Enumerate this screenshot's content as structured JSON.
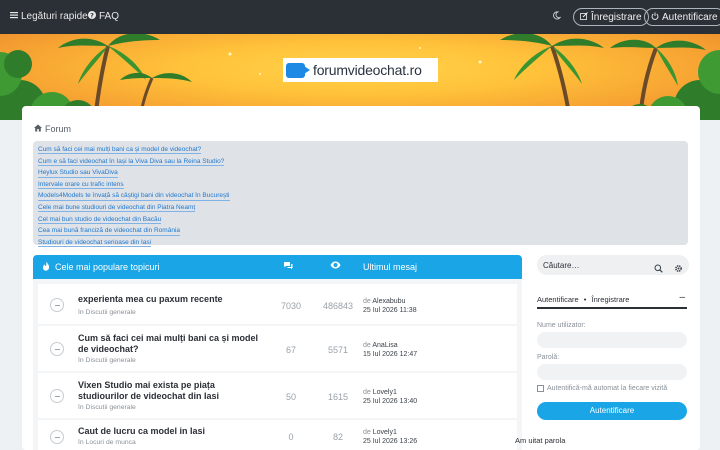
{
  "topbar": {
    "quick_links": "Legături rapide",
    "faq": "FAQ",
    "register": "Înregistrare",
    "login": "Autentificare"
  },
  "banner": {
    "logo_text": "forumvideochat.ro",
    "colors": {
      "sky": "#ffc23a",
      "leaves": "#2f7d2a"
    }
  },
  "breadcrumb": {
    "label": "Forum"
  },
  "links": [
    "Cum să faci cei mai mulți bani ca și model de videochat?",
    "Cum e să faci videochat în Iași la Viva Diva sau la Reina Studio?",
    "Heylux Studio sau VivaDiva",
    "Intervale orare cu trafic intens",
    "Models4Models te învață să câștigi bani din videochat în București",
    "Cele mai bune studiouri de videochat din Piatra Neamț",
    "Cel mai bun studio de videochat din Bacău",
    "Cea mai bună franciză de videochat din România",
    "Studiouri de videochat serioase din Iasi"
  ],
  "topics": {
    "header": "Cele mai populare topicuri",
    "last_post_header": "Ultimul mesaj",
    "accent": "#1aa5e6",
    "rows": [
      {
        "title": "experienta mea cu paxum recente",
        "forum": "în Discutii generale",
        "replies": "7030",
        "views": "486843",
        "by_prefix": "de",
        "author": "Alexabubu",
        "date": "25 Iul 2026 11:38"
      },
      {
        "title": "Cum să faci cei mai mulți bani ca și model de videochat?",
        "forum": "în Discutii generale",
        "replies": "67",
        "views": "5571",
        "by_prefix": "de",
        "author": "AnaLisa",
        "date": "15 Iul 2026 12:47"
      },
      {
        "title": "Vixen Studio mai exista pe piața studiourilor de videochat din Iasi",
        "forum": "în Discutii generale",
        "replies": "50",
        "views": "1615",
        "by_prefix": "de",
        "author": "Lovely1",
        "date": "25 Iul 2026 13:40"
      },
      {
        "title": "Caut de lucru ca model in Iasi",
        "forum": "în Locuri de munca",
        "replies": "0",
        "views": "82",
        "by_prefix": "de",
        "author": "Lovely1",
        "date": "25 Iul 2026 13:26"
      }
    ]
  },
  "sidebar": {
    "search_placeholder": "Căutare…",
    "login_tab": "Autentificare",
    "register_tab": "Înregistrare",
    "separator": "•",
    "collapse": "–",
    "username_label": "Nume utilizator:",
    "password_label": "Parolă:",
    "remember": "Autentifică-mă automat la fiecare vizită",
    "login_button": "Autentificare",
    "forgot": "Am uitat parola"
  }
}
